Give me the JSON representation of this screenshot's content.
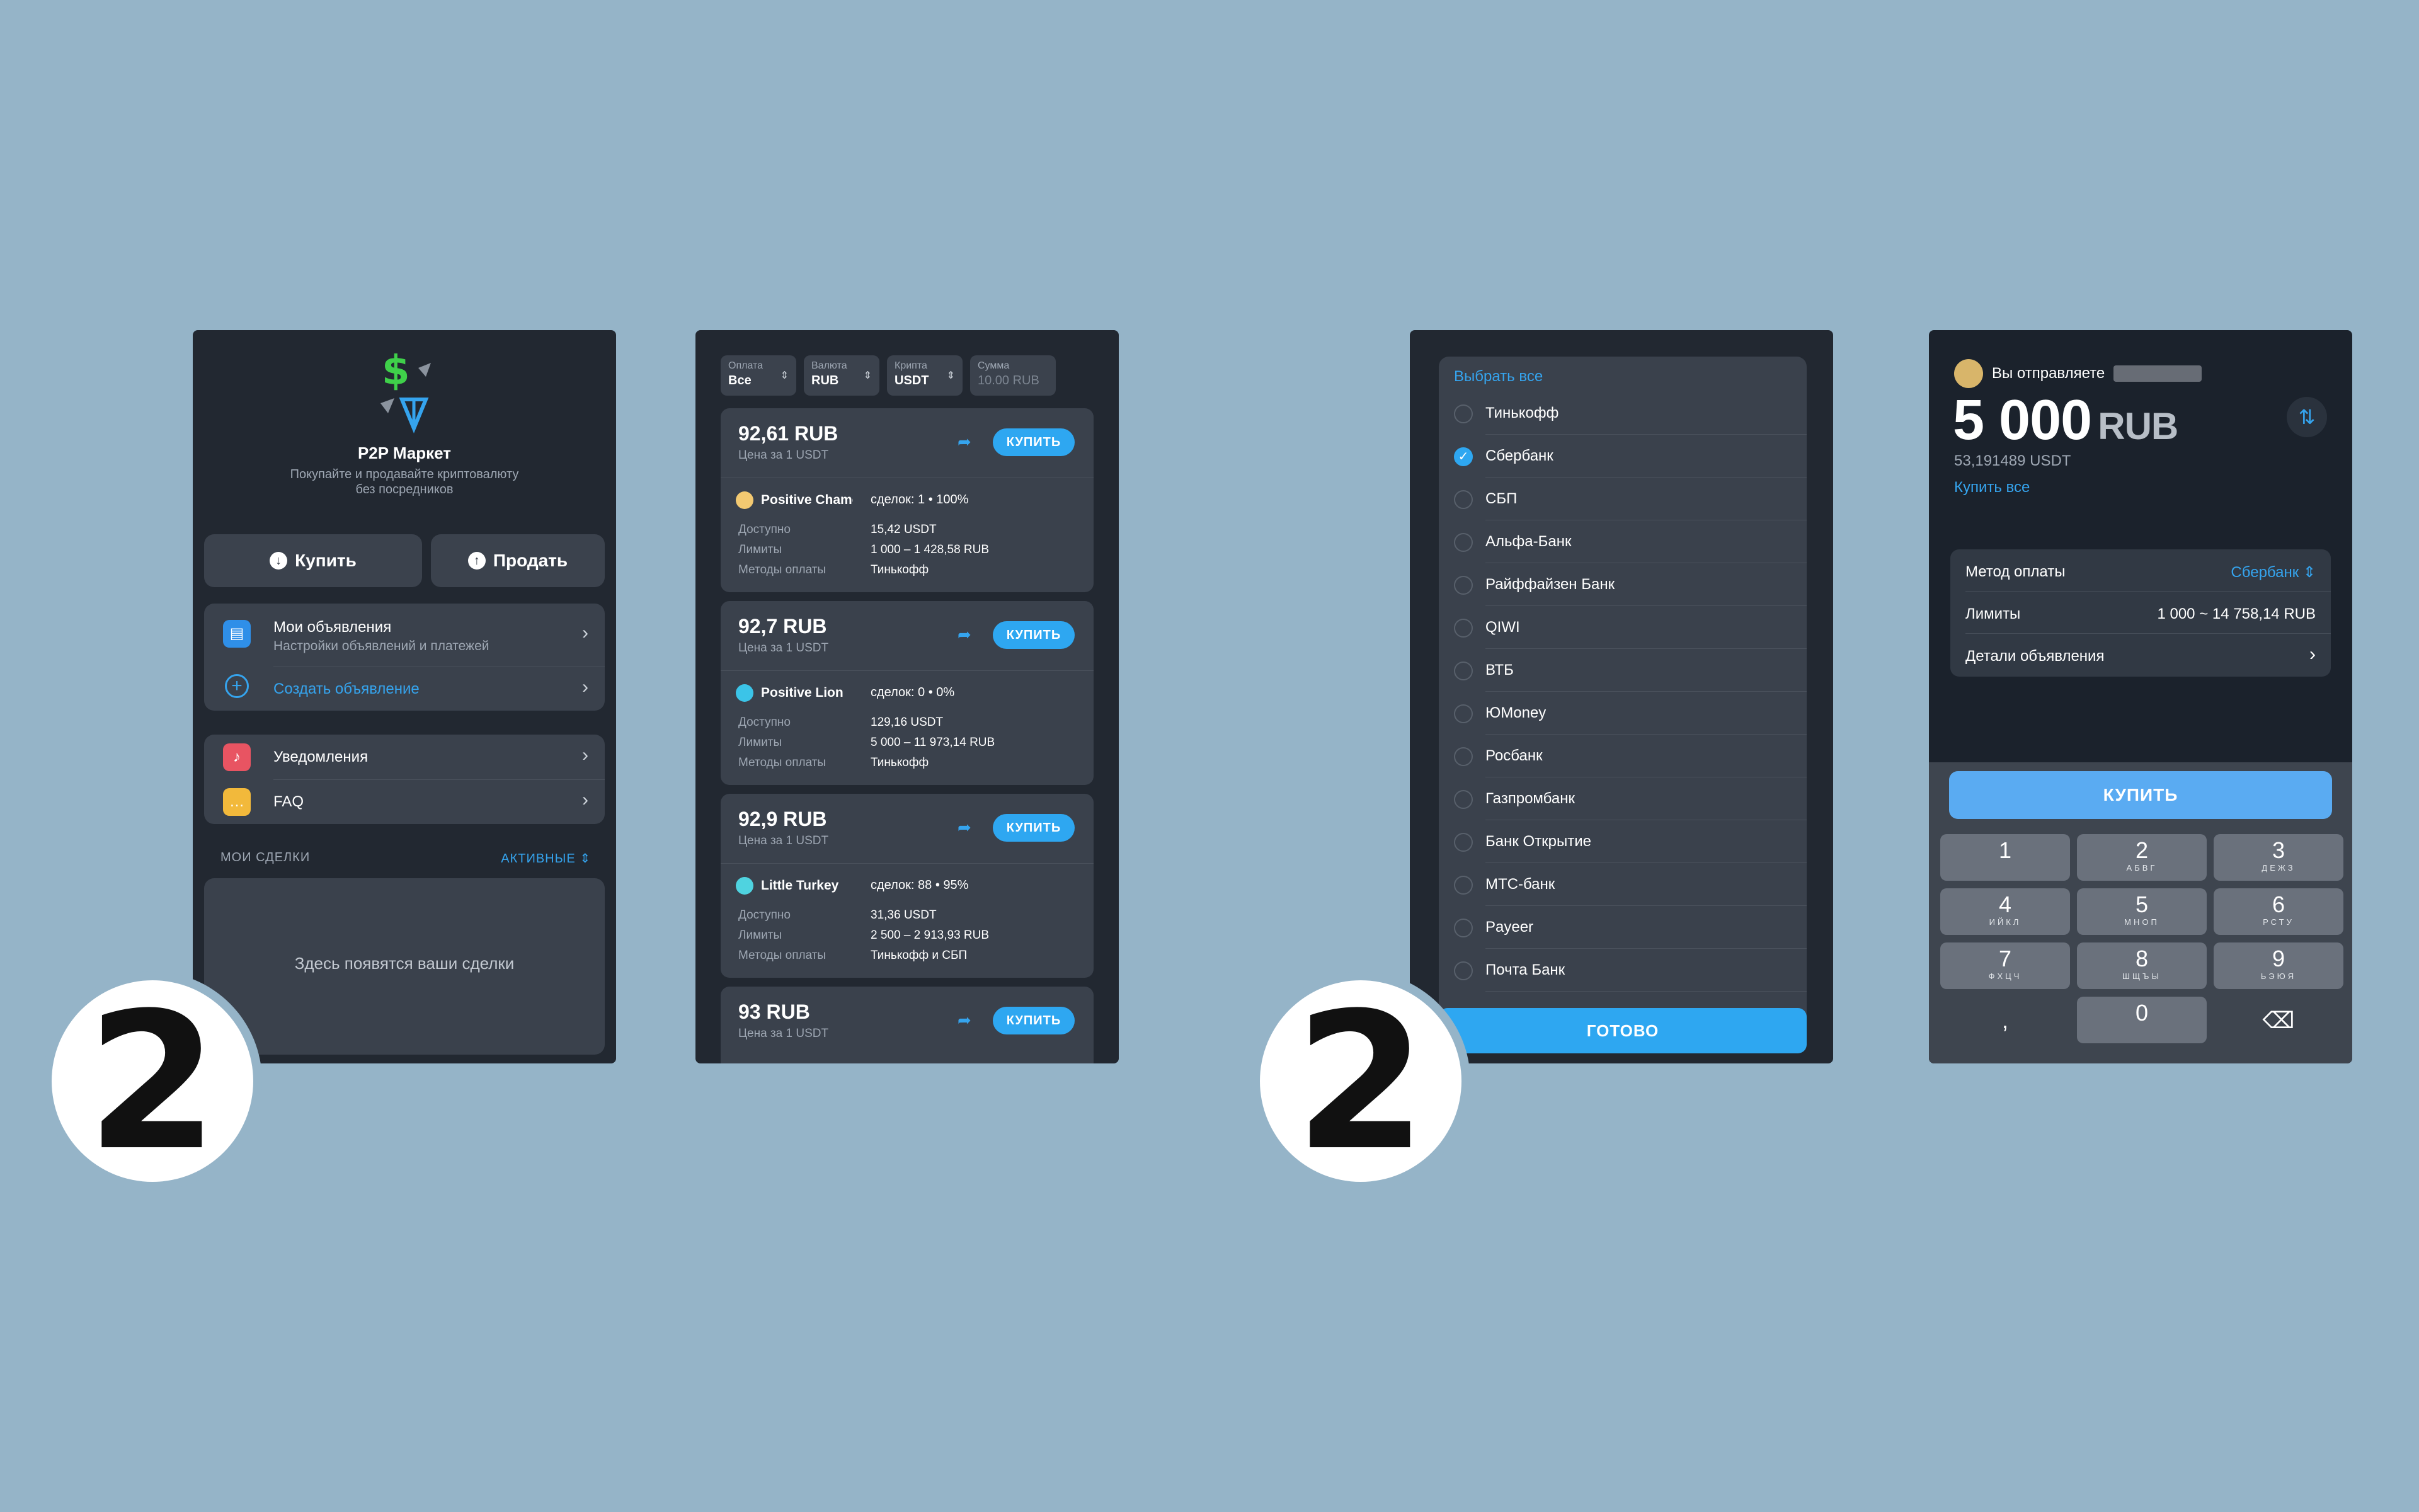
{
  "screen1": {
    "title": "P2P Маркет",
    "subtitle_line1": "Покупайте и продавайте криптовалюту",
    "subtitle_line2": "без посредников",
    "buy_label": "Купить",
    "sell_label": "Продать",
    "my_ads_title": "Мои объявления",
    "my_ads_sub": "Настройки объявлений и платежей",
    "create_ad": "Создать объявление",
    "notifications": "Уведомления",
    "faq": "FAQ",
    "deals_label": "МОИ СДЕЛКИ",
    "deals_filter": "АКТИВНЫЕ",
    "empty_text": "Здесь появятся ваши сделки"
  },
  "screen2": {
    "filters": [
      {
        "label": "Оплата",
        "value": "Все"
      },
      {
        "label": "Валюта",
        "value": "RUB"
      },
      {
        "label": "Крипта",
        "value": "USDT"
      },
      {
        "label": "Сумма",
        "value": "10.00 RUB"
      }
    ],
    "per_label": "Цена за 1 USDT",
    "buy_label": "КУПИТЬ",
    "available_label": "Доступно",
    "limits_label": "Лимиты",
    "methods_label": "Методы оплаты",
    "offers": [
      {
        "price": "92,61 RUB",
        "seller": "Positive Chameleon",
        "deals": "сделок: 1 • 100%",
        "available": "15,42 USDT",
        "limits": "1 000 – 1 428,58 RUB",
        "methods": "Тинькофф",
        "avatar_color": "#f3c971"
      },
      {
        "price": "92,7 RUB",
        "seller": "Positive Lion",
        "deals": "сделок: 0 • 0%",
        "available": "129,16 USDT",
        "limits": "5 000 – 11 973,14 RUB",
        "methods": "Тинькофф",
        "avatar_color": "#3bc4e8"
      },
      {
        "price": "92,9 RUB",
        "seller": "Little Turkey",
        "deals": "сделок: 88 • 95%",
        "available": "31,36 USDT",
        "limits": "2 500 – 2 913,93 RUB",
        "methods": "Тинькофф и СБП",
        "avatar_color": "#4fd3e0"
      },
      {
        "price": "93 RUB"
      }
    ]
  },
  "screen3": {
    "select_all": "Выбрать все",
    "banks": [
      {
        "name": "Тинькофф",
        "checked": false
      },
      {
        "name": "Сбербанк",
        "checked": true
      },
      {
        "name": "СБП",
        "checked": false
      },
      {
        "name": "Альфа-Банк",
        "checked": false
      },
      {
        "name": "Райффайзен Банк",
        "checked": false
      },
      {
        "name": "QIWI",
        "checked": false
      },
      {
        "name": "ВТБ",
        "checked": false
      },
      {
        "name": "ЮMoney",
        "checked": false
      },
      {
        "name": "Росбанк",
        "checked": false
      },
      {
        "name": "Газпромбанк",
        "checked": false
      },
      {
        "name": "Банк Открытие",
        "checked": false
      },
      {
        "name": "МТС-банк",
        "checked": false
      },
      {
        "name": "Payeer",
        "checked": false
      },
      {
        "name": "Почта Банк",
        "checked": false
      }
    ],
    "done_label": "ГОТОВО"
  },
  "screen4": {
    "sending_label": "Вы отправляете",
    "amount": "5 000",
    "currency": "RUB",
    "usdt_amount": "53,191489 USDT",
    "buy_all": "Купить все",
    "payment_method_label": "Метод оплаты",
    "payment_method_value": "Сбербанк",
    "limits_label": "Лимиты",
    "limits_value": "1 000 ~ 14 758,14 RUB",
    "details_label": "Детали объявления",
    "buy_label": "КУПИТЬ",
    "keys": [
      {
        "digit": "1",
        "letters": ""
      },
      {
        "digit": "2",
        "letters": "АБВГ"
      },
      {
        "digit": "3",
        "letters": "ДЕЖЗ"
      },
      {
        "digit": "4",
        "letters": "ИЙКЛ"
      },
      {
        "digit": "5",
        "letters": "МНОП"
      },
      {
        "digit": "6",
        "letters": "РСТУ"
      },
      {
        "digit": "7",
        "letters": "ФХЦЧ"
      },
      {
        "digit": "8",
        "letters": "ШЩЪЫ"
      },
      {
        "digit": "9",
        "letters": "ЬЭЮЯ"
      },
      {
        "digit": ",",
        "letters": ""
      },
      {
        "digit": "0",
        "letters": ""
      },
      {
        "digit": "⌫",
        "letters": ""
      }
    ]
  },
  "badges": {
    "badge1": "2",
    "badge2": "2"
  },
  "colors": {
    "background": "#95b4c8",
    "accent": "#2ea7f1",
    "screen": "#222831",
    "card": "#3a414c"
  }
}
